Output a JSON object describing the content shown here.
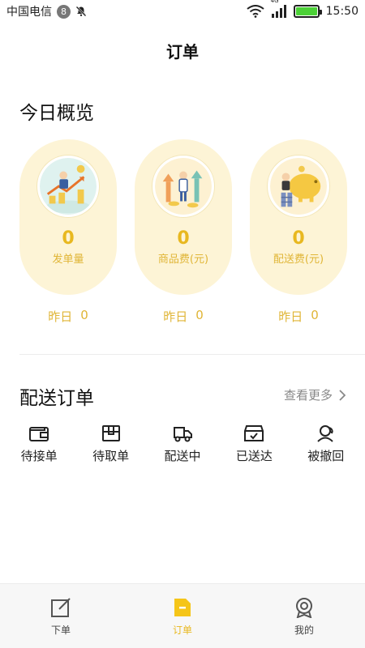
{
  "status_bar": {
    "carrier": "中国电信",
    "notification_count": "8",
    "network_label": "4G",
    "time": "15:50",
    "battery_level": 1.0
  },
  "header": {
    "title": "订单"
  },
  "overview": {
    "title": "今日概览",
    "cards": [
      {
        "value": "0",
        "label": "发单量",
        "yesterday_label": "昨日",
        "yesterday_value": "0",
        "icon": "growth-chart-illustration"
      },
      {
        "value": "0",
        "label": "商品费(元)",
        "yesterday_label": "昨日",
        "yesterday_value": "0",
        "icon": "rising-arrows-illustration"
      },
      {
        "value": "0",
        "label": "配送费(元)",
        "yesterday_label": "昨日",
        "yesterday_value": "0",
        "icon": "piggy-bank-illustration"
      }
    ]
  },
  "delivery": {
    "title": "配送订单",
    "more_label": "查看更多",
    "statuses": [
      {
        "label": "待接单",
        "icon": "wallet-icon"
      },
      {
        "label": "待取单",
        "icon": "box-icon"
      },
      {
        "label": "配送中",
        "icon": "truck-icon"
      },
      {
        "label": "已送达",
        "icon": "delivered-box-icon"
      },
      {
        "label": "被撤回",
        "icon": "withdrawn-person-icon"
      }
    ]
  },
  "bottom_nav": {
    "items": [
      {
        "label": "下单",
        "icon": "edit-icon",
        "active": false
      },
      {
        "label": "订单",
        "icon": "order-doc-icon",
        "active": true
      },
      {
        "label": "我的",
        "icon": "profile-badge-icon",
        "active": false
      }
    ]
  },
  "colors": {
    "accent": "#e8b820",
    "card_bg": "#fdf4d6"
  }
}
